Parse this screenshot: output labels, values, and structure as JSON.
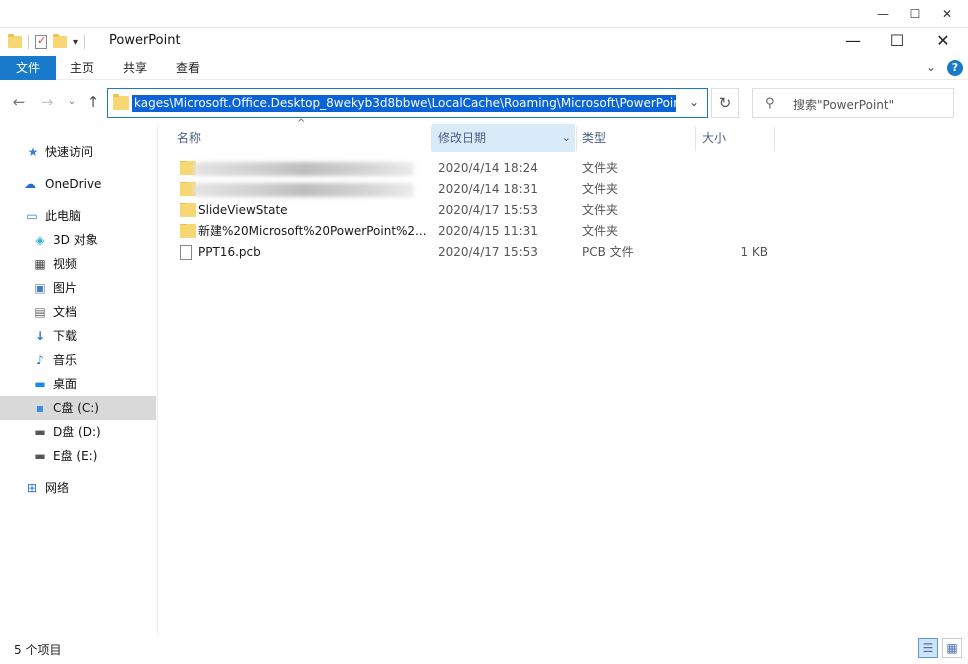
{
  "window": {
    "title": "PowerPoint"
  },
  "ribbon": {
    "tabs": [
      "文件",
      "主页",
      "共享",
      "查看"
    ]
  },
  "address": {
    "path": "kages\\Microsoft.Office.Desktop_8wekyb3d8bbwe\\LocalCache\\Roaming\\Microsoft\\PowerPoint"
  },
  "search": {
    "placeholder": "搜索\"PowerPoint\""
  },
  "sidebar": {
    "items": [
      {
        "label": "快速访问",
        "icon": "star-icon"
      },
      {
        "label": "OneDrive",
        "icon": "cloud-icon"
      },
      {
        "label": "此电脑",
        "icon": "computer-icon"
      },
      {
        "label": "3D 对象",
        "icon": "cube-icon"
      },
      {
        "label": "视频",
        "icon": "video-icon"
      },
      {
        "label": "图片",
        "icon": "picture-icon"
      },
      {
        "label": "文档",
        "icon": "document-icon"
      },
      {
        "label": "下载",
        "icon": "download-icon"
      },
      {
        "label": "音乐",
        "icon": "music-icon"
      },
      {
        "label": "桌面",
        "icon": "desktop-icon"
      },
      {
        "label": "C盘 (C:)",
        "icon": "drive-icon",
        "selected": true
      },
      {
        "label": "D盘 (D:)",
        "icon": "drive-icon"
      },
      {
        "label": "E盘 (E:)",
        "icon": "drive-icon"
      },
      {
        "label": "网络",
        "icon": "network-icon"
      }
    ]
  },
  "columns": {
    "name": "名称",
    "date": "修改日期",
    "type": "类型",
    "size": "大小"
  },
  "files": [
    {
      "name": "",
      "date": "2020/4/14 18:24",
      "type": "文件夹",
      "size": "",
      "blurred": true
    },
    {
      "name": "",
      "date": "2020/4/14 18:31",
      "type": "文件夹",
      "size": "",
      "blurred": true
    },
    {
      "name": "SlideViewState",
      "date": "2020/4/17 15:53",
      "type": "文件夹",
      "size": ""
    },
    {
      "name": "新建%20Microsoft%20PowerPoint%2...",
      "date": "2020/4/15 11:31",
      "type": "文件夹",
      "size": ""
    },
    {
      "name": "PPT16.pcb",
      "date": "2020/4/17 15:53",
      "type": "PCB 文件",
      "size": "1 KB"
    }
  ],
  "status": {
    "count": "5 个项目"
  }
}
